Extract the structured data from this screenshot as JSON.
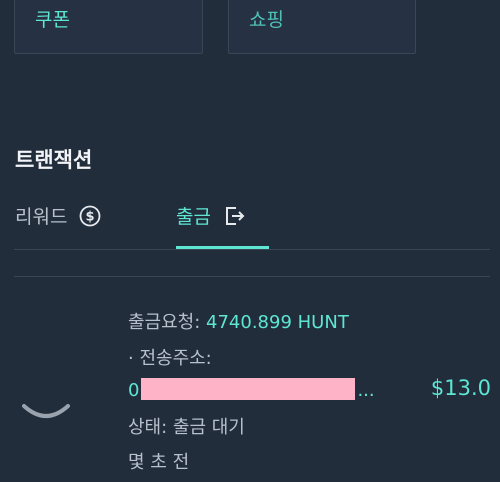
{
  "cards": {
    "coupon_label": "쿠폰",
    "shopping_label": "쇼핑"
  },
  "transactions": {
    "title": "트랜잭션",
    "tabs": [
      {
        "label": "리워드",
        "icon": "dollar-circle-icon"
      },
      {
        "label": "출금",
        "icon": "export-icon"
      }
    ]
  },
  "item": {
    "request_label": "출금요청: ",
    "request_value": "4740.899 HUNT",
    "address_label": "· 전송주소:",
    "address_prefix": "0",
    "address_suffix": "...",
    "amount": "$13.0",
    "status": "상태: 출금 대기",
    "time": "몇 초 전"
  },
  "colors": {
    "background": "#222d3c",
    "accent": "#5ee6d3",
    "muted_text": "#b7c0cb",
    "redaction": "#ffb3c6"
  }
}
